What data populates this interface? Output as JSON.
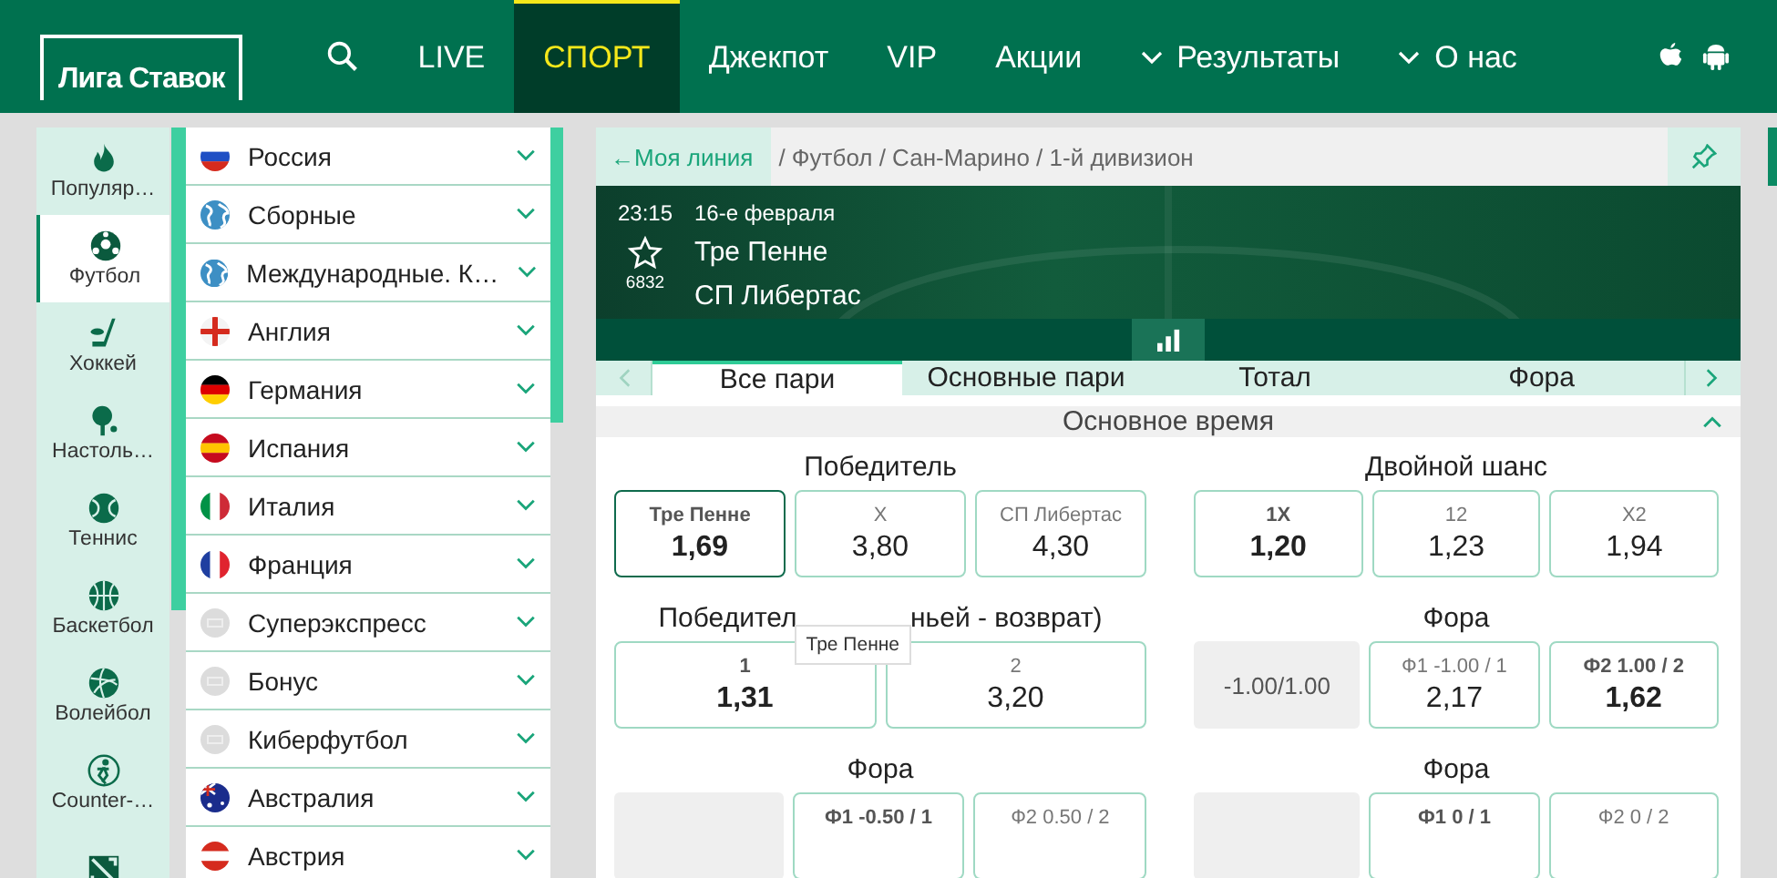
{
  "header": {
    "logo": "Лига Ставок",
    "nav": [
      {
        "label": "LIVE",
        "selected": false,
        "caret": false
      },
      {
        "label": "СПОРТ",
        "selected": true,
        "caret": false
      },
      {
        "label": "Джекпот",
        "selected": false,
        "caret": false
      },
      {
        "label": "VIP",
        "selected": false,
        "caret": false
      },
      {
        "label": "Акции",
        "selected": false,
        "caret": false
      },
      {
        "label": "Результаты",
        "selected": false,
        "caret": true
      },
      {
        "label": "О нас",
        "selected": false,
        "caret": true
      }
    ]
  },
  "sports": [
    {
      "kind": "flame",
      "label": "Популяр…",
      "selected": false
    },
    {
      "kind": "ball",
      "label": "Футбол",
      "selected": true
    },
    {
      "kind": "hockey",
      "label": "Хоккей",
      "selected": false
    },
    {
      "kind": "pingpong",
      "label": "Настоль…",
      "selected": false
    },
    {
      "kind": "tennis",
      "label": "Теннис",
      "selected": false
    },
    {
      "kind": "basketball",
      "label": "Баскетбол",
      "selected": false
    },
    {
      "kind": "volleyball",
      "label": "Волейбол",
      "selected": false
    },
    {
      "kind": "shooter",
      "label": "Counter-…",
      "selected": false
    },
    {
      "kind": "dota"
    }
  ],
  "countries": [
    {
      "kind": "ru",
      "label": "Россия"
    },
    {
      "kind": "globe",
      "label": "Сборные"
    },
    {
      "kind": "globe",
      "label": "Международные. К…"
    },
    {
      "kind": "en",
      "label": "Англия"
    },
    {
      "kind": "de",
      "label": "Германия"
    },
    {
      "kind": "es",
      "label": "Испания"
    },
    {
      "kind": "it",
      "label": "Италия"
    },
    {
      "kind": "fr",
      "label": "Франция"
    },
    {
      "kind": "blank",
      "label": "Суперэкспресс"
    },
    {
      "kind": "blank",
      "label": "Бонус"
    },
    {
      "kind": "blank",
      "label": "Киберфутбол"
    },
    {
      "kind": "au",
      "label": "Австралия"
    },
    {
      "kind": "at",
      "label": "Австрия"
    }
  ],
  "breadcrumb": {
    "back": "←Моя линия",
    "path": "/ Футбол / Сан-Марино / 1-й дивизион"
  },
  "match": {
    "time": "23:15",
    "date": "16-е февраля",
    "home": "Тре Пенне",
    "away": "СП Либертас",
    "favorites": "6832"
  },
  "tabs": [
    {
      "label": "Все пари",
      "selected": true
    },
    {
      "label": "Основные пари",
      "selected": false
    },
    {
      "label": "Тотал",
      "selected": false
    },
    {
      "label": "Фора",
      "selected": false
    }
  ],
  "section": {
    "title": "Основное время",
    "expanded": true
  },
  "markets": [
    {
      "kind": "plain",
      "title": "Победитель",
      "outcomes": [
        {
          "label": "Тре Пенне",
          "odd": "1,69",
          "bold": true,
          "selected": true
        },
        {
          "label": "X",
          "odd": "3,80",
          "bold": false,
          "selected": false
        },
        {
          "label": "СП Либертас",
          "odd": "4,30",
          "bold": false,
          "selected": false
        }
      ]
    },
    {
      "kind": "plain",
      "title": "Двойной шанс",
      "outcomes": [
        {
          "label": "1X",
          "odd": "1,20",
          "bold": true,
          "selected": false
        },
        {
          "label": "12",
          "odd": "1,23",
          "bold": false,
          "selected": false
        },
        {
          "label": "X2",
          "odd": "1,94",
          "bold": false,
          "selected": false
        }
      ]
    },
    {
      "kind": "plain",
      "title": "Победител",
      "title_end": "ньей - возврат)",
      "tooltip": "Тре Пенне",
      "outcomes": [
        {
          "label": "1",
          "odd": "1,31",
          "bold": true,
          "selected": false
        },
        {
          "label": "2",
          "odd": "3,20",
          "bold": false,
          "selected": false
        }
      ]
    },
    {
      "kind": "handicap",
      "title": "Фора",
      "line": "-1.00/1.00",
      "outcomes": [
        {
          "label": "Ф1 -1.00 / 1",
          "odd": "2,17",
          "bold": false,
          "selected": false
        },
        {
          "label": "Ф2 1.00 / 2",
          "odd": "1,62",
          "bold": true,
          "selected": false
        }
      ]
    },
    {
      "kind": "handicap",
      "title": "Фора",
      "outcomes": [
        {
          "label": "Ф1 -0.50 / 1",
          "bold": true,
          "selected": false
        },
        {
          "label": "Ф2 0.50 / 2",
          "bold": false,
          "selected": false
        }
      ]
    },
    {
      "kind": "handicap",
      "title": "Фора",
      "outcomes": [
        {
          "label": "Ф1 0 / 1",
          "bold": true,
          "selected": false
        },
        {
          "label": "Ф2 0 / 2",
          "bold": false,
          "selected": false
        }
      ]
    }
  ]
}
